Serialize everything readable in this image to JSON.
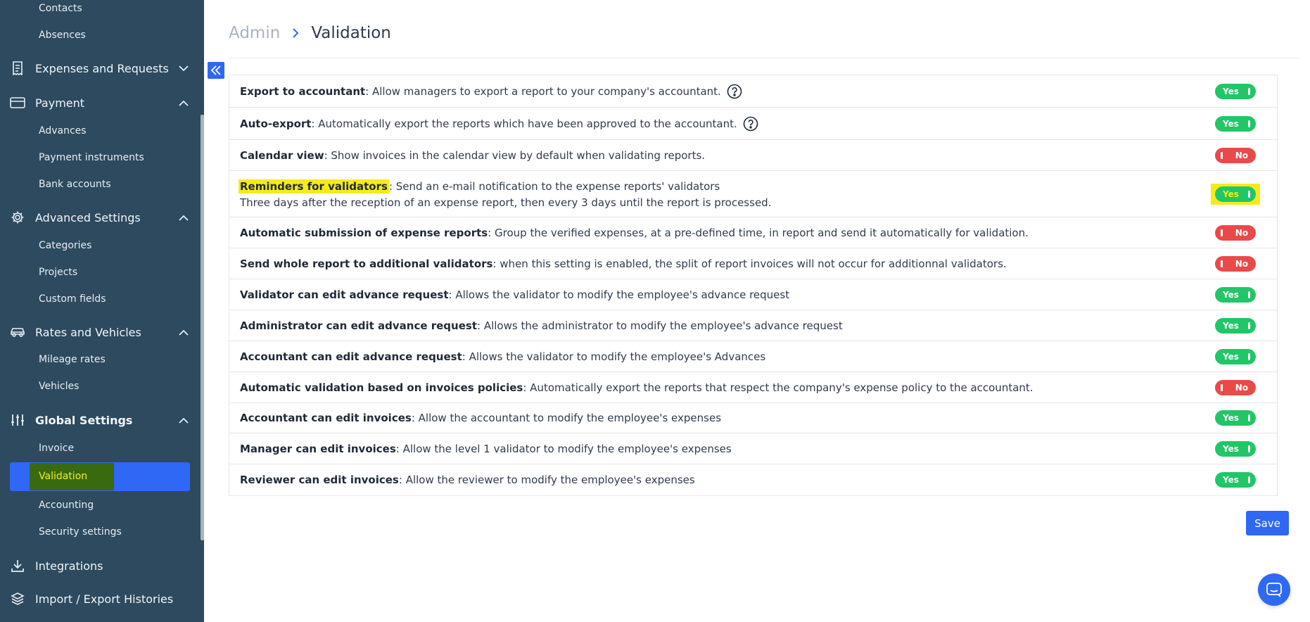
{
  "sidebar": {
    "top_items": [
      {
        "label": "Contacts"
      },
      {
        "label": "Absences"
      }
    ],
    "groups": [
      {
        "label": "Expenses and Requests",
        "icon": "receipt-icon",
        "expanded": false
      },
      {
        "label": "Payment",
        "icon": "card-icon",
        "expanded": true,
        "items": [
          "Advances",
          "Payment instruments",
          "Bank accounts"
        ]
      },
      {
        "label": "Advanced Settings",
        "icon": "gear-icon",
        "expanded": true,
        "items": [
          "Categories",
          "Projects",
          "Custom fields"
        ]
      },
      {
        "label": "Rates and Vehicles",
        "icon": "car-icon",
        "expanded": true,
        "items": [
          "Mileage rates",
          "Vehicles"
        ]
      },
      {
        "label": "Global Settings",
        "icon": "sliders-icon",
        "expanded": true,
        "items": [
          "Invoice",
          "Validation",
          "Accounting",
          "Security settings"
        ]
      },
      {
        "label": "Integrations",
        "icon": "download-icon"
      },
      {
        "label": "Import / Export Histories",
        "icon": "layers-icon"
      }
    ],
    "active_item": "Validation"
  },
  "breadcrumb": {
    "parent": "Admin",
    "current": "Validation"
  },
  "settings": [
    {
      "title": "Export to accountant",
      "desc": ": Allow managers to export a report to your company's accountant.",
      "help": true,
      "value": "Yes"
    },
    {
      "title": "Auto-export",
      "desc": ": Automatically export the reports which have been approved to the accountant.",
      "help": true,
      "value": "Yes"
    },
    {
      "title": "Calendar view",
      "desc": ": Show invoices in the calendar view by default when validating reports.",
      "value": "No"
    },
    {
      "title": "Reminders for validators",
      "desc": ": Send an e-mail notification to the expense reports' validators",
      "desc2": "Three days after the reception of an expense report, then every 3 days until the report is processed.",
      "value": "Yes",
      "highlighted": true
    },
    {
      "title": "Automatic submission of expense reports",
      "desc": ": Group the verified expenses, at a pre-defined time, in report and send it automatically for validation.",
      "value": "No"
    },
    {
      "title": "Send whole report to additional validators",
      "desc": ": when this setting is enabled, the split of report invoices will not occur for additionnal validators.",
      "value": "No"
    },
    {
      "title": "Validator can edit advance request",
      "desc": ": Allows the validator to modify the employee's advance request",
      "value": "Yes"
    },
    {
      "title": "Administrator can edit advance request",
      "desc": ": Allows the administrator to modify the employee's advance request",
      "value": "Yes"
    },
    {
      "title": "Accountant can edit advance request",
      "desc": ": Allows the validator to modify the employee's Advances",
      "value": "Yes"
    },
    {
      "title": "Automatic validation based on invoices policies",
      "desc": ": Automatically export the reports that respect the company's expense policy to the accountant.",
      "value": "No"
    },
    {
      "title": "Accountant can edit invoices",
      "desc": ": Allow the accountant to modify the employee's expenses",
      "value": "Yes"
    },
    {
      "title": "Manager can edit invoices",
      "desc": ": Allow the level 1 validator to modify the employee's expenses",
      "value": "Yes"
    },
    {
      "title": "Reviewer can edit invoices",
      "desc": ": Allow the reviewer to modify the employee's expenses",
      "value": "Yes"
    }
  ],
  "actions": {
    "save_label": "Save"
  },
  "colors": {
    "sidebar_bg": "#2d4a5e",
    "accent": "#2f68f5",
    "yes": "#21c667",
    "no": "#e84a4a",
    "highlight": "#f7ea1b"
  }
}
